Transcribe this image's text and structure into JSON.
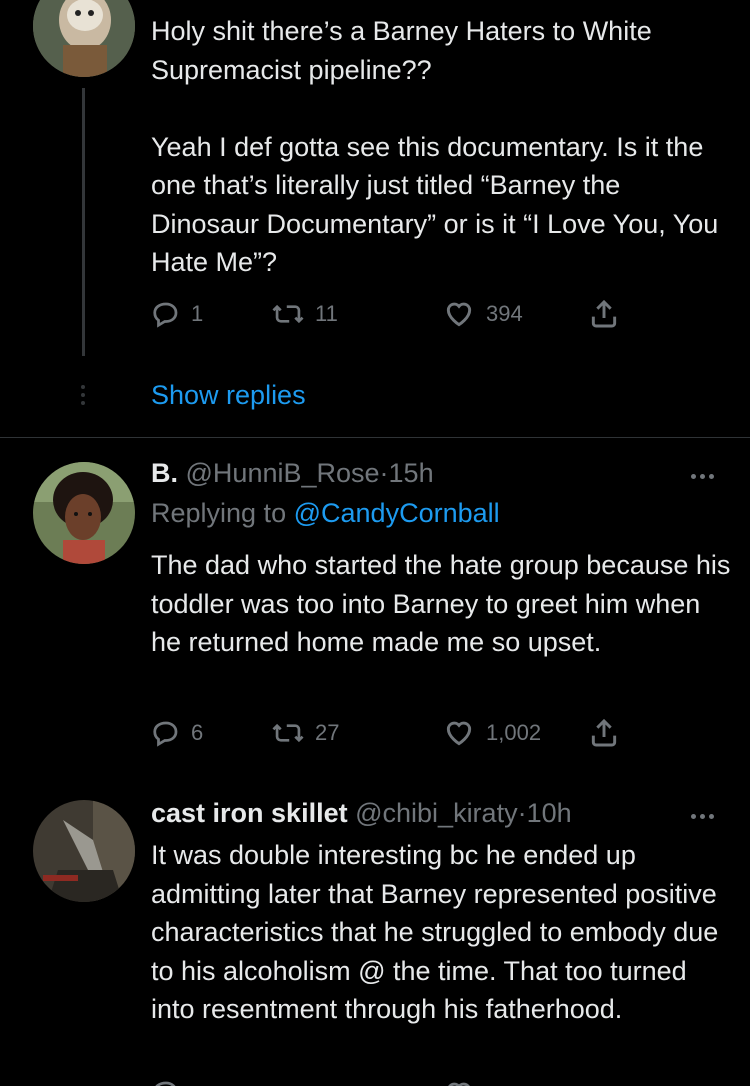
{
  "tweet1": {
    "text": "Holy shit there’s a Barney Haters to White Supremacist pipeline??\n\nYeah I def gotta see this documentary. Is it the one that’s literally just titled “Barney the Dinosaur Documentary” or is it “I Love You, You Hate Me”?",
    "replies": "1",
    "retweets": "11",
    "likes": "394",
    "show_replies": "Show replies"
  },
  "tweet2": {
    "display_name": "B.",
    "handle": "@HunniB_Rose",
    "sep": "·",
    "time": "15h",
    "replying_prefix": "Replying to",
    "replying_to": "@CandyCornball",
    "text": "The dad who started the hate group because his toddler was too into Barney to greet him when he returned home made me so upset.",
    "replies": "6",
    "retweets": "27",
    "likes": "1,002"
  },
  "tweet3": {
    "display_name": "cast iron skillet",
    "handle": "@chibi_kiraty",
    "sep": "·",
    "time": "10h",
    "text": "It was double interesting bc he ended up admitting later that Barney represented positive characteristics that he struggled to embody due to his alcoholism @ the time. That too turned into resentment through his fatherhood."
  },
  "icons": [
    "reply-icon",
    "retweet-icon",
    "like-icon",
    "share-icon",
    "more-icon"
  ],
  "colors": {
    "background": "#000000",
    "text": "#e7e9ea",
    "muted": "#71767b",
    "link": "#1d9bf0",
    "divider": "#2f3336"
  }
}
